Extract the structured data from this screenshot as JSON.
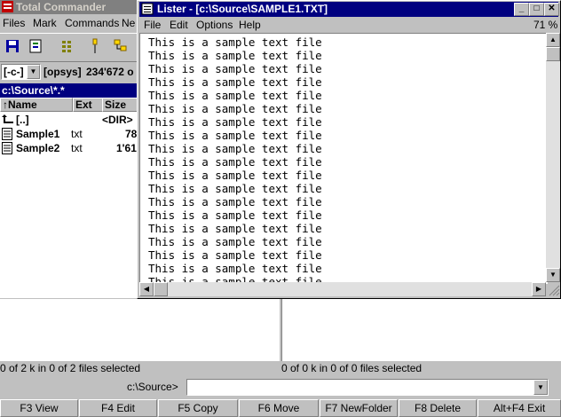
{
  "tc": {
    "title": "Total Commander",
    "menu": [
      "Files",
      "Mark",
      "Commands",
      "Ne"
    ],
    "drive": "[-c-]",
    "volume": "[opsys]",
    "free": "234'672 o",
    "path": "c:\\Source\\*.*",
    "columns": {
      "name": "↑Name",
      "ext": "Ext",
      "size": "Size"
    },
    "files": [
      {
        "name": "[..]",
        "ext": "",
        "size": "<DIR>"
      },
      {
        "name": "Sample1",
        "ext": "txt",
        "size": "78"
      },
      {
        "name": "Sample2",
        "ext": "txt",
        "size": "1'61"
      }
    ],
    "status_left": "0 of 2 k in 0 of 2 files selected",
    "status_right": "0 of 0 k in 0 of 0 files selected",
    "cmd_prompt": "c:\\Source>",
    "fkeys": [
      "F3 View",
      "F4 Edit",
      "F5 Copy",
      "F6 Move",
      "F7 NewFolder",
      "F8 Delete",
      "Alt+F4 Exit"
    ]
  },
  "lister": {
    "title": "Lister - [c:\\Source\\SAMPLE1.TXT]",
    "menu": [
      "File",
      "Edit",
      "Options",
      "Help"
    ],
    "percent": "71 %",
    "lines": [
      "This is a sample text file",
      "This is a sample text file",
      "This is a sample text file",
      "This is a sample text file",
      "This is a sample text file",
      "This is a sample text file",
      "This is a sample text file",
      "This is a sample text file",
      "This is a sample text file",
      "This is a sample text file",
      "This is a sample text file",
      "This is a sample text file",
      "This is a sample text file",
      "This is a sample text file",
      "This is a sample text file",
      "This is a sample text file",
      "This is a sample text file",
      "This is a sample text file",
      "This is a sample text file"
    ]
  }
}
